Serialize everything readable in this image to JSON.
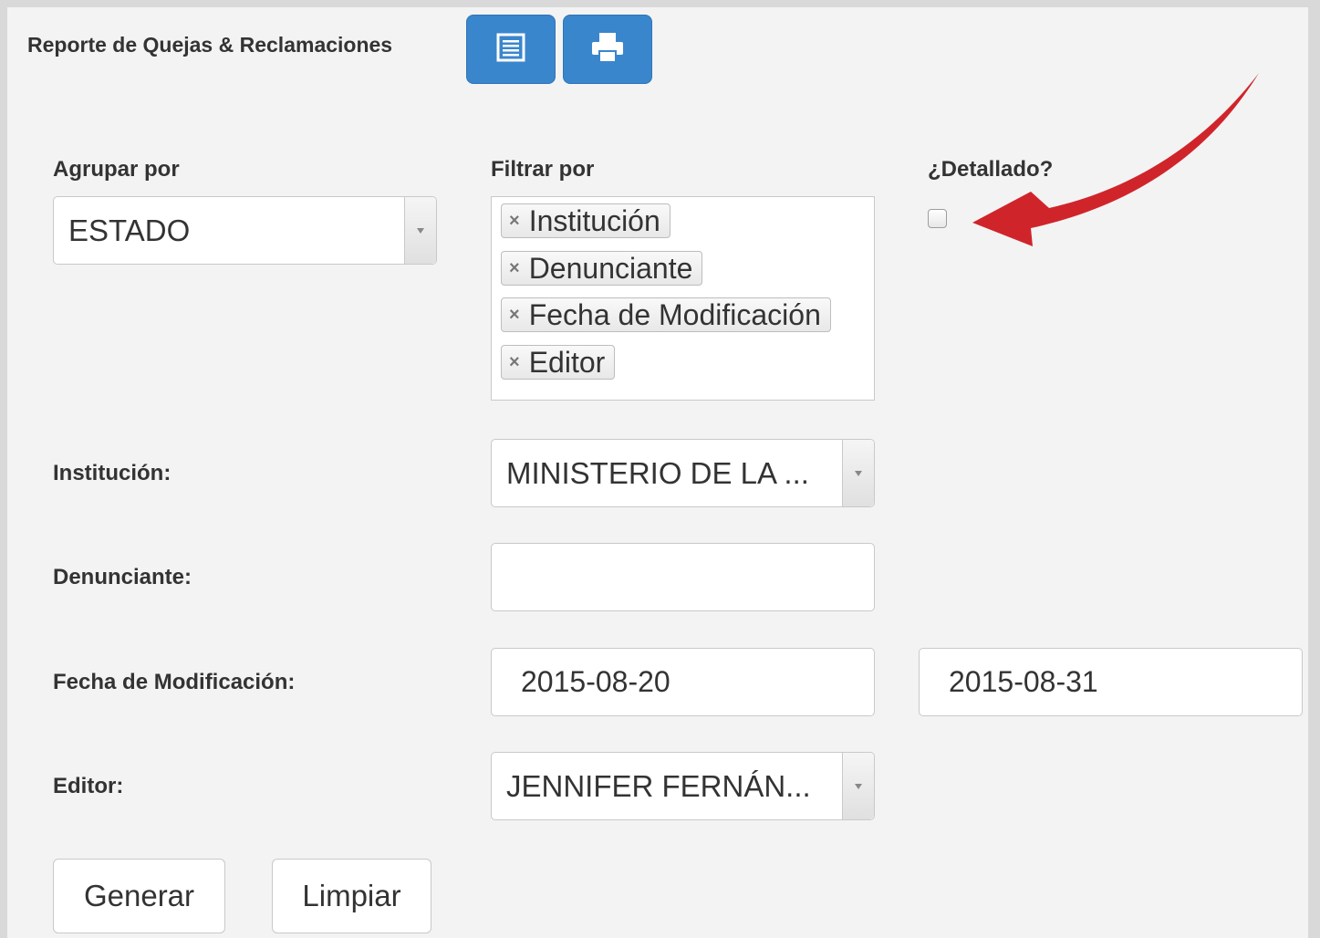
{
  "header": {
    "title": "Reporte de Quejas & Reclamaciones",
    "buttons": [
      {
        "icon": "list-icon",
        "color": "#3a86cd"
      },
      {
        "icon": "print-icon",
        "color": "#3a86cd"
      }
    ]
  },
  "group_by": {
    "label": "Agrupar por",
    "value": "ESTADO"
  },
  "filter_by": {
    "label": "Filtrar por",
    "chips": [
      "Institución",
      "Denunciante",
      "Fecha de Modificación",
      "Editor"
    ]
  },
  "detailed": {
    "label": "¿Detallado?",
    "checked": false
  },
  "fields": {
    "institucion": {
      "label": "Institución:",
      "value": "MINISTERIO DE LA ..."
    },
    "denunciante": {
      "label": "Denunciante:",
      "value": ""
    },
    "fecha": {
      "label": "Fecha de Modificación:",
      "from": "2015-08-20",
      "to": "2015-08-31"
    },
    "editor": {
      "label": "Editor:",
      "value": "JENNIFER FERNÁN..."
    }
  },
  "actions": {
    "generate": "Generar",
    "clear": "Limpiar"
  },
  "annotation": {
    "arrow_color": "#d0242b"
  }
}
